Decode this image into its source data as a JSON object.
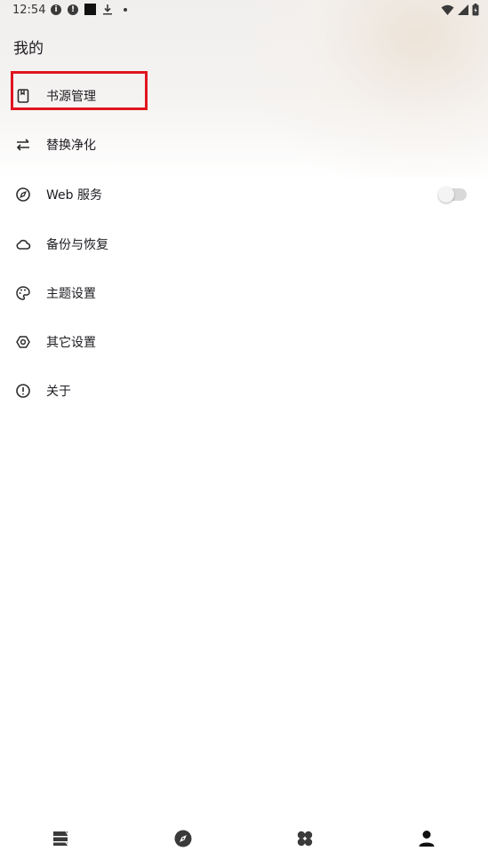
{
  "status_bar": {
    "time": "12:54",
    "icons": [
      "info-icon",
      "alert-icon",
      "square-icon",
      "download-icon",
      "dot-icon",
      "wifi-icon",
      "signal-icon",
      "battery-icon"
    ]
  },
  "page": {
    "title": "我的"
  },
  "menu": {
    "items": [
      {
        "label": "书源管理",
        "icon": "book-icon"
      },
      {
        "label": "替换净化",
        "icon": "swap-icon"
      },
      {
        "label": "Web 服务",
        "icon": "compass-icon",
        "switch_on": false
      },
      {
        "label": "备份与恢复",
        "icon": "cloud-icon"
      },
      {
        "label": "主题设置",
        "icon": "palette-icon"
      },
      {
        "label": "其它设置",
        "icon": "settings-icon"
      },
      {
        "label": "关于",
        "icon": "info-alert-icon"
      }
    ]
  },
  "bottom_nav": {
    "items": [
      {
        "icon": "bookshelf-icon",
        "selected": false
      },
      {
        "icon": "explore-icon",
        "selected": false
      },
      {
        "icon": "rss-icon",
        "selected": false
      },
      {
        "icon": "person-icon",
        "selected": true
      }
    ]
  },
  "colors": {
    "highlight": "#e0151f",
    "text": "#1d1b20",
    "icon": "#2b2b2b"
  }
}
